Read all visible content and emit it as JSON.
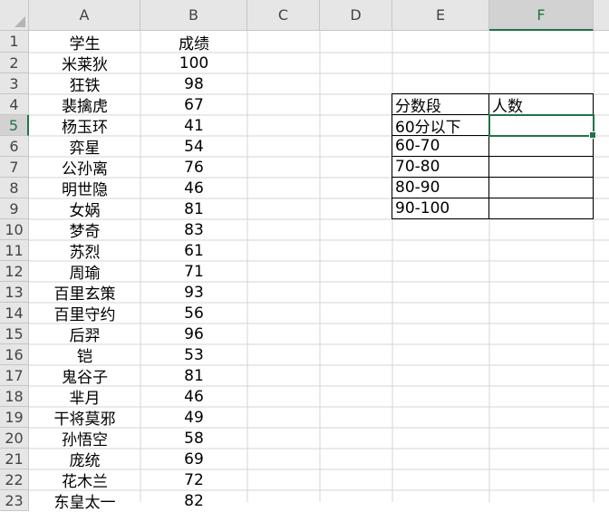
{
  "columns": [
    "A",
    "B",
    "C",
    "D",
    "E",
    "F"
  ],
  "selected_column": "F",
  "selected_row": "5",
  "row_numbers": [
    "1",
    "2",
    "3",
    "4",
    "5",
    "6",
    "7",
    "8",
    "9",
    "10",
    "11",
    "12",
    "13",
    "14",
    "15",
    "16",
    "17",
    "18",
    "19",
    "20",
    "21",
    "22",
    "23"
  ],
  "header_row": {
    "A": "学生",
    "B": "成绩"
  },
  "students": [
    {
      "name": "米莱狄",
      "score": "100"
    },
    {
      "name": "狂铁",
      "score": "98"
    },
    {
      "name": "裴擒虎",
      "score": "67"
    },
    {
      "name": "杨玉环",
      "score": "41"
    },
    {
      "name": "弈星",
      "score": "54"
    },
    {
      "name": "公孙离",
      "score": "76"
    },
    {
      "name": "明世隐",
      "score": "46"
    },
    {
      "name": "女娲",
      "score": "81"
    },
    {
      "name": "梦奇",
      "score": "83"
    },
    {
      "name": "苏烈",
      "score": "61"
    },
    {
      "name": "周瑜",
      "score": "71"
    },
    {
      "name": "百里玄策",
      "score": "93"
    },
    {
      "name": "百里守约",
      "score": "56"
    },
    {
      "name": "后羿",
      "score": "96"
    },
    {
      "name": "铠",
      "score": "53"
    },
    {
      "name": "鬼谷子",
      "score": "81"
    },
    {
      "name": "芈月",
      "score": "46"
    },
    {
      "name": "干将莫邪",
      "score": "49"
    },
    {
      "name": "孙悟空",
      "score": "58"
    },
    {
      "name": "庞统",
      "score": "69"
    },
    {
      "name": "花木兰",
      "score": "72"
    },
    {
      "name": "东皇太一",
      "score": "82"
    }
  ],
  "summary_table": {
    "header_segment": "分数段",
    "header_count": "人数",
    "segments": [
      "60分以下",
      "60-70",
      "70-80",
      "80-90",
      "90-100"
    ]
  },
  "colors": {
    "accent": "#217346",
    "header_bg": "#e6e6e6",
    "grid": "#d4d4d4"
  }
}
